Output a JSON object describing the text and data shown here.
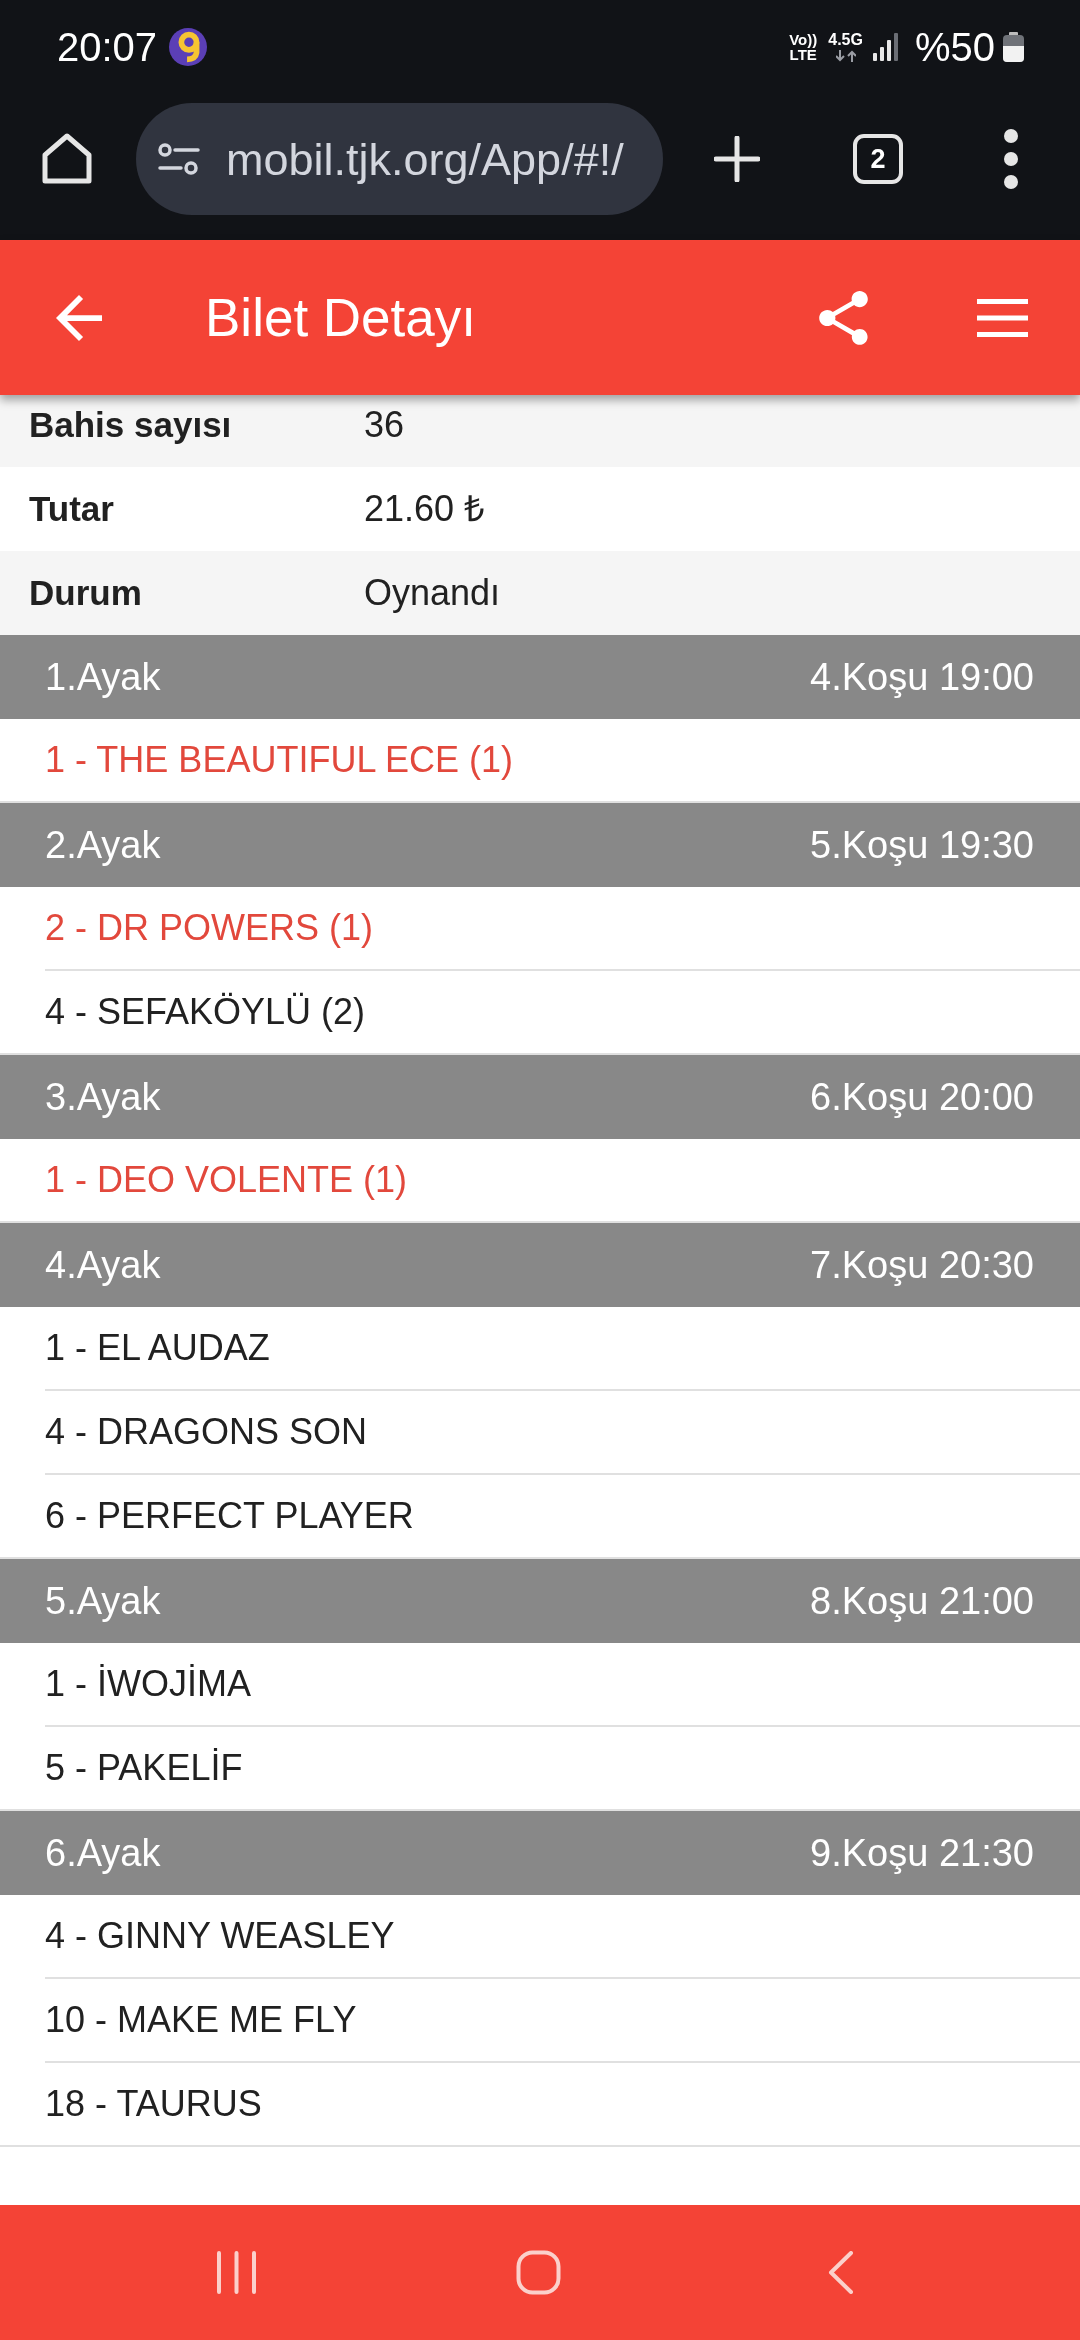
{
  "status_bar": {
    "time": "20:07",
    "volte": [
      "Vo))",
      "LTE"
    ],
    "network": "4.5G",
    "battery": "%50"
  },
  "browser": {
    "url": "mobil.tjk.org/App/#!/",
    "tab_count": "2"
  },
  "header": {
    "title": "Bilet Detayı"
  },
  "details": [
    {
      "label": "Bahis sayısı",
      "value": "36"
    },
    {
      "label": "Tutar",
      "value": "21.60 ₺"
    },
    {
      "label": "Durum",
      "value": "Oynandı"
    }
  ],
  "legs": [
    {
      "title": "1.Ayak",
      "race": "4.Koşu 19:00",
      "horses": [
        {
          "text": "1 - THE BEAUTIFUL ECE (1)",
          "highlighted": true
        }
      ]
    },
    {
      "title": "2.Ayak",
      "race": "5.Koşu 19:30",
      "horses": [
        {
          "text": "2 - DR POWERS (1)",
          "highlighted": true
        },
        {
          "text": "4 - SEFAKÖYLÜ (2)",
          "highlighted": false
        }
      ]
    },
    {
      "title": "3.Ayak",
      "race": "6.Koşu 20:00",
      "horses": [
        {
          "text": "1 - DEO VOLENTE (1)",
          "highlighted": true
        }
      ]
    },
    {
      "title": "4.Ayak",
      "race": "7.Koşu 20:30",
      "horses": [
        {
          "text": "1 - EL AUDAZ",
          "highlighted": false
        },
        {
          "text": "4 - DRAGONS SON",
          "highlighted": false
        },
        {
          "text": "6 - PERFECT PLAYER",
          "highlighted": false
        }
      ]
    },
    {
      "title": "5.Ayak",
      "race": "8.Koşu 21:00",
      "horses": [
        {
          "text": "1 - İWOJİMA",
          "highlighted": false
        },
        {
          "text": "5 - PAKELİF",
          "highlighted": false
        }
      ]
    },
    {
      "title": "6.Ayak",
      "race": "9.Koşu 21:30",
      "horses": [
        {
          "text": "4 - GINNY WEASLEY",
          "highlighted": false
        },
        {
          "text": "10 - MAKE ME FLY",
          "highlighted": false
        },
        {
          "text": "18 - TAURUS",
          "highlighted": false
        }
      ]
    }
  ]
}
